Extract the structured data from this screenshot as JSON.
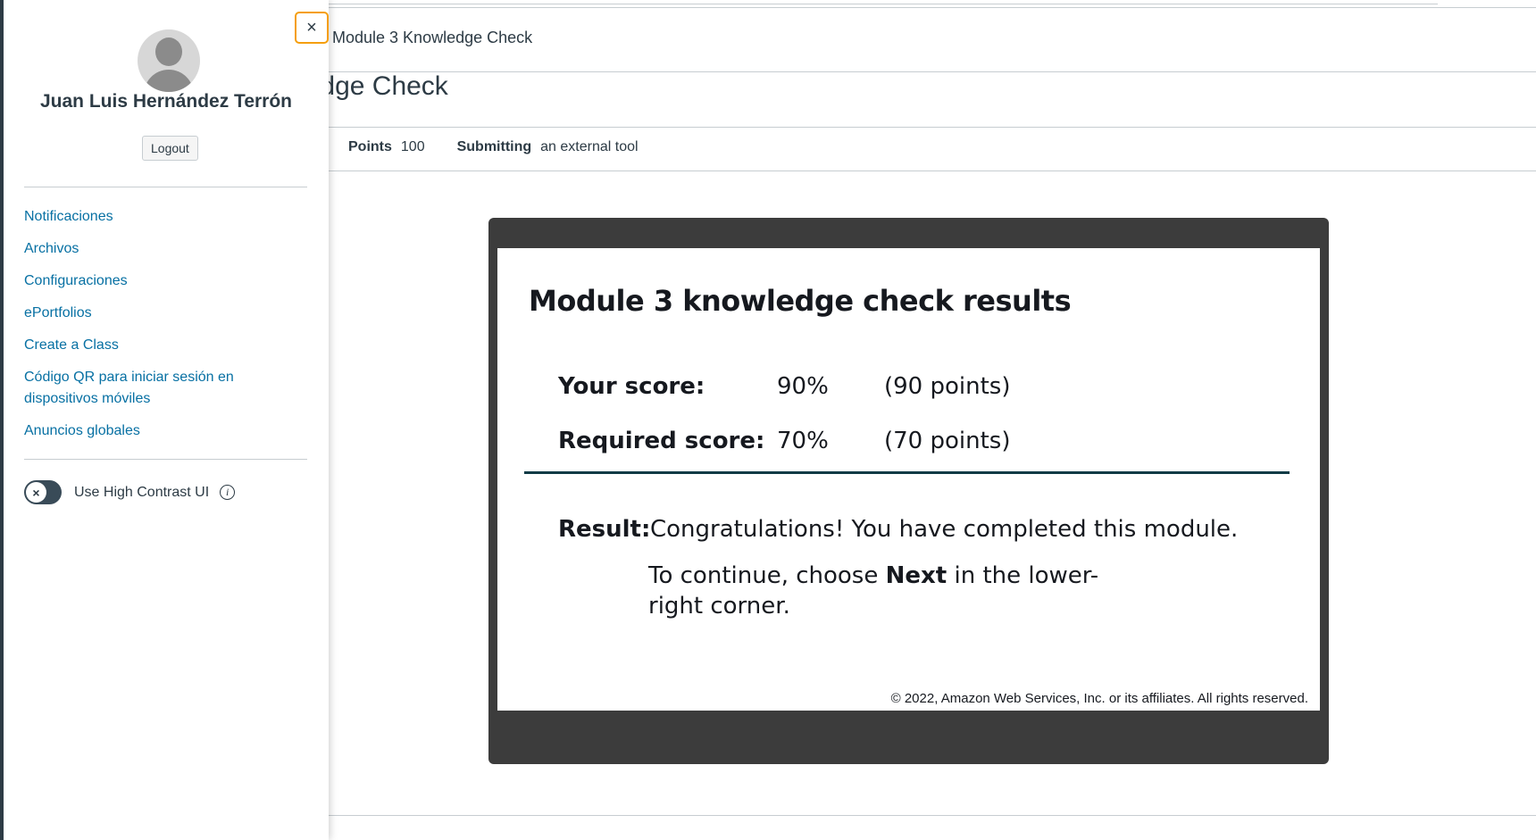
{
  "page": {
    "breadcrumb": "Module 3 Knowledge Check",
    "title": "nowledge Check",
    "points_label": "Points",
    "points_value": "100",
    "submitting_label": "Submitting",
    "submitting_value": "an external tool"
  },
  "tool": {
    "title": "Module 3 knowledge check results",
    "your_score_label": "Your score:",
    "your_score_pct": "90%",
    "your_score_points": "(90 points)",
    "required_score_label": "Required score:",
    "required_score_pct": "70%",
    "required_score_points": "(70 points)",
    "result_label": "Result:",
    "result_text": "Congratulations! You have completed this module.",
    "continue_prefix": "To continue, choose ",
    "continue_bold": "Next",
    "continue_suffix": " in the lower-right corner.",
    "copyright": "© 2022, Amazon Web Services, Inc. or its affiliates. All rights reserved."
  },
  "tray": {
    "close_glyph": "×",
    "user_name": "Juan Luis Hernández Terrón",
    "logout_label": "Logout",
    "links": [
      "Notificaciones",
      "Archivos",
      "Configuraciones",
      "ePortfolios",
      "Create a Class",
      "Código QR para iniciar sesión en dispositivos móviles",
      "Anuncios globales"
    ],
    "high_contrast_label": "Use High Contrast UI",
    "high_contrast_on": false,
    "toggle_glyph": "×",
    "info_glyph": "i"
  },
  "colors": {
    "link": "#0770a3",
    "text": "#2d3b45",
    "focus_ring": "#f59e0b",
    "tool_frame": "#3c3c3c",
    "divider": "#0f3b46"
  }
}
